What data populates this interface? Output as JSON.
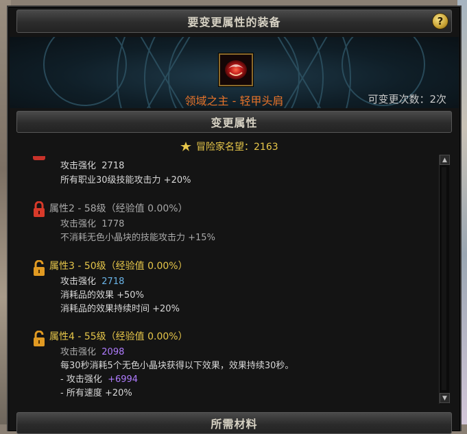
{
  "window": {
    "title": "要变更属性的装备",
    "help_label": "?"
  },
  "equipment": {
    "name": "领域之主 - 轻甲头肩",
    "change_count_label": "可变更次数：2次",
    "icon": "equipment-shoulder-icon"
  },
  "sections": {
    "change_attributes": "变更属性",
    "required_materials": "所需材料"
  },
  "reputation": {
    "label": "冒险家名望：2163",
    "icon": "adventurer-fame-icon"
  },
  "properties": [
    {
      "header": "",
      "lines": [
        {
          "text": "攻击强化",
          "value": "2718"
        },
        {
          "text": "所有职业30级技能攻击力 +20%",
          "value": ""
        }
      ]
    },
    {
      "header": "属性2 - 58级（经验值 0.00%）",
      "lock_color": "#d83a2a",
      "lines": [
        {
          "text": "攻击强化",
          "value": "1778"
        },
        {
          "text": "不消耗无色小晶块的技能攻击力 +15%",
          "value": ""
        }
      ]
    },
    {
      "header": "属性3 - 50级（经验值 0.00%）",
      "lock_color": "#e19a22",
      "lines": [
        {
          "text": "攻击强化",
          "value": "2718"
        },
        {
          "text": "消耗品的效果 +50%",
          "value": ""
        },
        {
          "text": "消耗品的效果持续时间 +20%",
          "value": ""
        }
      ]
    },
    {
      "header": "属性4 - 55级（经验值 0.00%）",
      "lock_color": "#e19a22",
      "lines": [
        {
          "text": "攻击强化",
          "value": "2098"
        },
        {
          "text": "每30秒消耗5个无色小晶块获得以下效果，效果持续30秒。",
          "value": ""
        },
        {
          "text": "- 攻击强化",
          "value": "+6994"
        },
        {
          "text": "- 所有速度 +20%",
          "value": ""
        }
      ]
    }
  ],
  "scrollbar": {
    "up_label": "▲",
    "down_label": "▼"
  },
  "colors": {
    "gray_text": "#a9a9a9",
    "gold_text": "#e7c74a",
    "blue_value": "#6ab4e8",
    "purple_value": "#b07cff",
    "orange_name": "#e8742a"
  }
}
